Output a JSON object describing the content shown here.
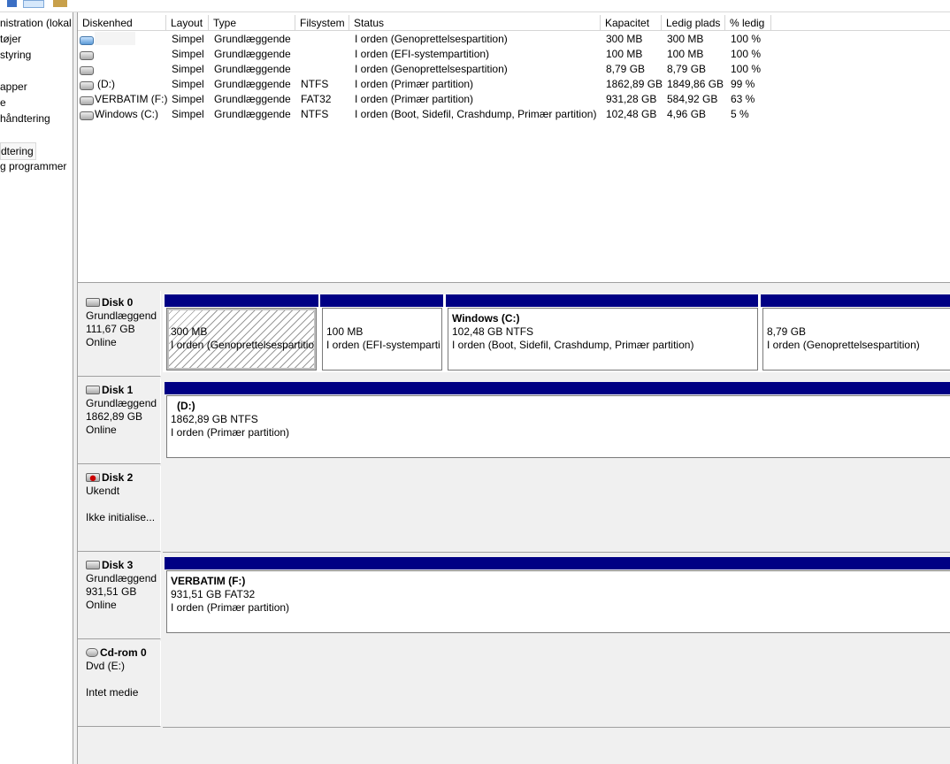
{
  "tree": {
    "items": [
      {
        "label": "nistration (lokal"
      },
      {
        "label": "tøjer"
      },
      {
        "label": "styring"
      },
      {
        "label": ""
      },
      {
        "label": "apper"
      },
      {
        "label": "e"
      },
      {
        "label": "håndtering"
      },
      {
        "label": ""
      },
      {
        "label": "dtering"
      },
      {
        "label": "g programmer"
      }
    ]
  },
  "list": {
    "headers": [
      "Diskenhed",
      "Layout",
      "Type",
      "Filsystem",
      "Status",
      "Kapacitet",
      "Ledig plads",
      "% ledig"
    ],
    "rows": [
      {
        "name": "",
        "layout": "Simpel",
        "type": "Grundlæggende",
        "fs": "",
        "status": "I orden (Genoprettelsespartition)",
        "cap": "300 MB",
        "free": "300 MB",
        "pct": "100 %",
        "icon": "volume-blue-icon"
      },
      {
        "name": "",
        "layout": "Simpel",
        "type": "Grundlæggende",
        "fs": "",
        "status": "I orden (EFI-systempartition)",
        "cap": "100 MB",
        "free": "100 MB",
        "pct": "100 %",
        "icon": "volume-icon"
      },
      {
        "name": "",
        "layout": "Simpel",
        "type": "Grundlæggende",
        "fs": "",
        "status": "I orden (Genoprettelsespartition)",
        "cap": "8,79 GB",
        "free": "8,79 GB",
        "pct": "100 %",
        "icon": "volume-icon"
      },
      {
        "name": "(D:)",
        "layout": "Simpel",
        "type": "Grundlæggende",
        "fs": "NTFS",
        "status": "I orden (Primær partition)",
        "cap": "1862,89 GB",
        "free": "1849,86 GB",
        "pct": "99 %",
        "icon": "volume-icon"
      },
      {
        "name": "VERBATIM (F:)",
        "layout": "Simpel",
        "type": "Grundlæggende",
        "fs": "FAT32",
        "status": "I orden (Primær partition)",
        "cap": "931,28 GB",
        "free": "584,92 GB",
        "pct": "63 %",
        "icon": "volume-icon"
      },
      {
        "name": "Windows (C:)",
        "layout": "Simpel",
        "type": "Grundlæggende",
        "fs": "NTFS",
        "status": "I orden (Boot, Sidefil, Crashdump, Primær partition)",
        "cap": "102,48 GB",
        "free": "4,96 GB",
        "pct": "5 %",
        "icon": "volume-icon"
      }
    ]
  },
  "disks": {
    "disk0": {
      "name": "Disk 0",
      "type": "Grundlæggend",
      "size": "111,67 GB",
      "state": "Online",
      "parts": [
        {
          "title": "",
          "line1": "300 MB",
          "line2": "I orden (Genoprettelsespartitio"
        },
        {
          "title": "",
          "line1": "100 MB",
          "line2": "I orden (EFI-systemparti"
        },
        {
          "title": "Windows  (C:)",
          "line1": "102,48 GB NTFS",
          "line2": "I orden (Boot, Sidefil, Crashdump, Primær partition)"
        },
        {
          "title": "",
          "line1": "8,79 GB",
          "line2": "I orden (Genoprettelsespartition)"
        }
      ]
    },
    "disk1": {
      "name": "Disk 1",
      "type": "Grundlæggend",
      "size": "1862,89 GB",
      "state": "Online",
      "parts": [
        {
          "title": "(D:)",
          "line1": "1862,89 GB NTFS",
          "line2": "I orden (Primær partition)"
        }
      ]
    },
    "disk2": {
      "name": "Disk 2",
      "type": "Ukendt",
      "state": "Ikke initialise..."
    },
    "disk3": {
      "name": "Disk 3",
      "type": "Grundlæggend",
      "size": "931,51 GB",
      "state": "Online",
      "parts": [
        {
          "title": "VERBATIM  (F:)",
          "line1": "931,51 GB FAT32",
          "line2": "I orden (Primær partition)"
        }
      ]
    },
    "cdrom0": {
      "name": "Cd-rom 0",
      "type": "Dvd (E:)",
      "state": "Intet medie"
    }
  },
  "colors": {
    "primary_partition": "#000084",
    "pane_bg": "#f0f0f0"
  }
}
